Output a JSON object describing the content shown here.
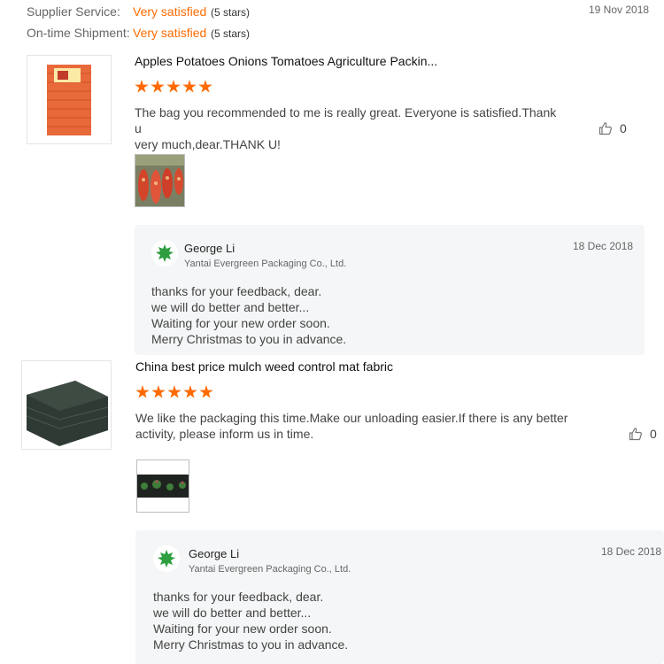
{
  "ratings": {
    "supplier_service": {
      "label": "Supplier Service:",
      "value": "Very satisfied",
      "stars": "(5 stars)"
    },
    "on_time_shipment": {
      "label": "On-time Shipment:",
      "value": "Very satisfied",
      "stars": "(5 stars)"
    },
    "date": "19 Nov 2018"
  },
  "reviews": [
    {
      "product_title": "Apples Potatoes Onions Tomatoes Agriculture Packin...",
      "rating": 5,
      "text_lines": [
        "The bag you recommended to me is really great. Everyone is satisfied.Thank u",
        "very much,dear.THANK U!"
      ],
      "helpful_count": "0",
      "reply": {
        "name": "George Li",
        "company": "Yantai Evergreen Packaging Co., Ltd.",
        "date": "18 Dec 2018",
        "lines": [
          "thanks for your feedback, dear.",
          "we will do better and better...",
          "Waiting for your new order soon.",
          "Merry Christmas to you in advance."
        ]
      }
    },
    {
      "product_title": "China best price mulch weed control mat fabric",
      "rating": 5,
      "text_lines": [
        "We like the packaging this time.Make our unloading easier.If there is any better",
        "activity, please inform us in time."
      ],
      "helpful_count": "0",
      "reply": {
        "name": "George Li",
        "company": "Yantai Evergreen Packaging Co., Ltd.",
        "date": "18 Dec 2018",
        "lines": [
          "thanks for your feedback, dear.",
          "we will do better and better...",
          "Waiting for your new order soon.",
          "Merry Christmas to you in advance."
        ]
      }
    }
  ],
  "colors": {
    "accent": "#ff6a00",
    "reply_bg": "#f5f6f7",
    "leaf": "#2e9e3e"
  },
  "icons": {
    "helpful": "thumbs-up-icon",
    "avatar": "leaf-logo-icon",
    "star": "star-icon"
  }
}
